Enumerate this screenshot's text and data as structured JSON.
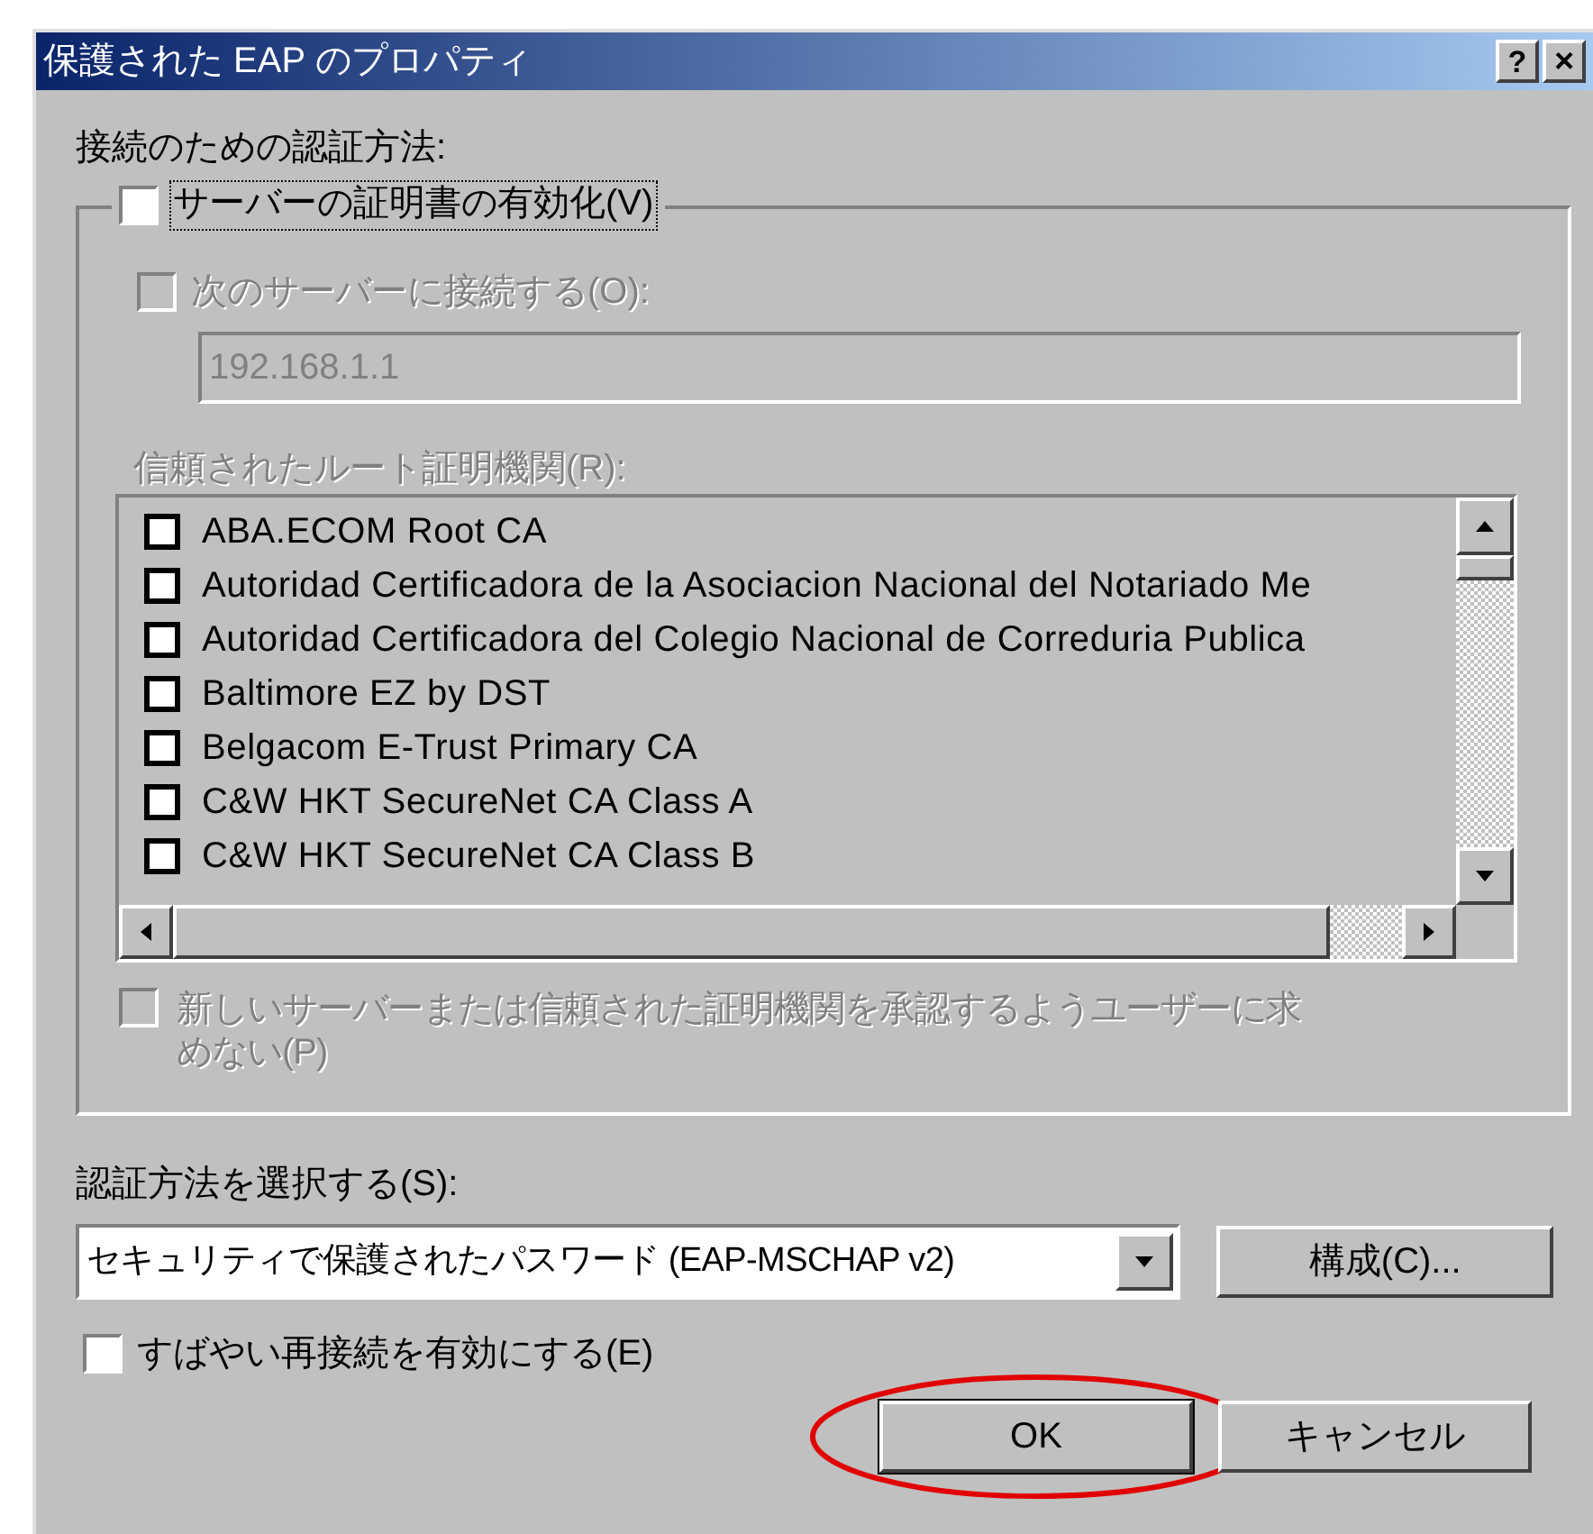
{
  "window": {
    "title": "保護された EAP のプロパティ",
    "help_button": "?",
    "close_button": "×"
  },
  "auth_label": "接続のための認証方法:",
  "validate_cert": {
    "label": "サーバーの証明書の有効化(V)",
    "checked": false,
    "disabled": false
  },
  "connect_servers": {
    "label": "次のサーバーに接続する(O):",
    "checked": false,
    "disabled": true
  },
  "server_field": {
    "value": "192.168.1.1",
    "disabled": true
  },
  "root_ca_label": {
    "label": "信頼されたルート証明機関(R):",
    "disabled": true
  },
  "root_ca_list": [
    {
      "name": "ABA.ECOM Root CA",
      "checked": false
    },
    {
      "name": "Autoridad Certificadora de la Asociacion Nacional del Notariado Me",
      "checked": false
    },
    {
      "name": "Autoridad Certificadora del Colegio Nacional de Correduria Publica",
      "checked": false
    },
    {
      "name": "Baltimore EZ by DST",
      "checked": false
    },
    {
      "name": "Belgacom E-Trust Primary CA",
      "checked": false
    },
    {
      "name": "C&W HKT SecureNet CA Class A",
      "checked": false
    },
    {
      "name": "C&W HKT SecureNet CA Class B",
      "checked": false
    }
  ],
  "no_prompt": {
    "label": "新しいサーバーまたは信頼された証明機関を承認するようユーザーに求めない(P)",
    "checked": false,
    "disabled": true
  },
  "method_label": "認証方法を選択する(S):",
  "method_select": {
    "value": "セキュリティで保護されたパスワード (EAP-MSCHAP v2)"
  },
  "configure_button": "構成(C)...",
  "fast_reconnect": {
    "label": "すばやい再接続を有効にする(E)",
    "checked": false,
    "disabled": false
  },
  "buttons": [
    {
      "label": "OK",
      "highlighted": true
    },
    {
      "label": "キャンセル",
      "highlighted": false
    }
  ]
}
